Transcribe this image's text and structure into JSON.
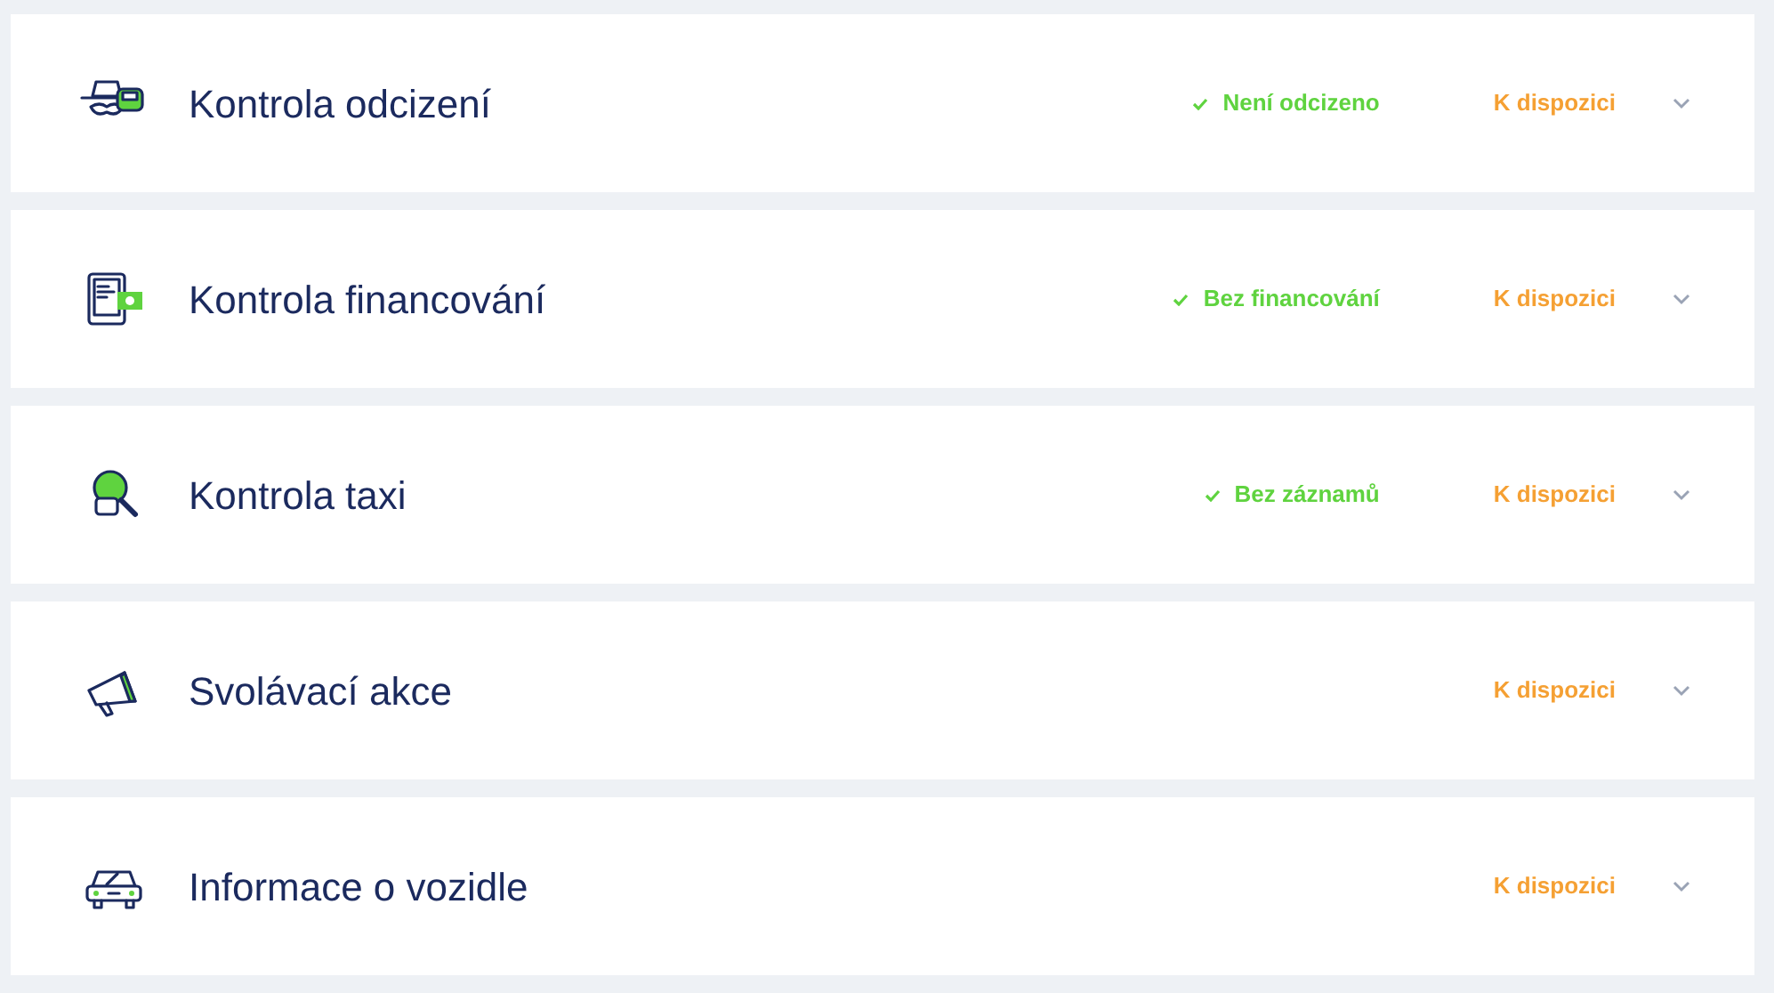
{
  "checks": [
    {
      "title": "Kontrola odcizení",
      "result": "Není odcizeno",
      "availability": "K dispozici",
      "expanded": false
    },
    {
      "title": "Kontrola financování",
      "result": "Bez financování",
      "availability": "K dispozici",
      "expanded": false
    },
    {
      "title": "Kontrola taxi",
      "result": "Bez záznamů",
      "availability": "K dispozici",
      "expanded": false
    },
    {
      "title": "Svolávací akce",
      "availability": "K dispozici",
      "expanded": false
    },
    {
      "title": "Informace o vozidle",
      "availability": "K dispozici",
      "expanded": false
    }
  ]
}
